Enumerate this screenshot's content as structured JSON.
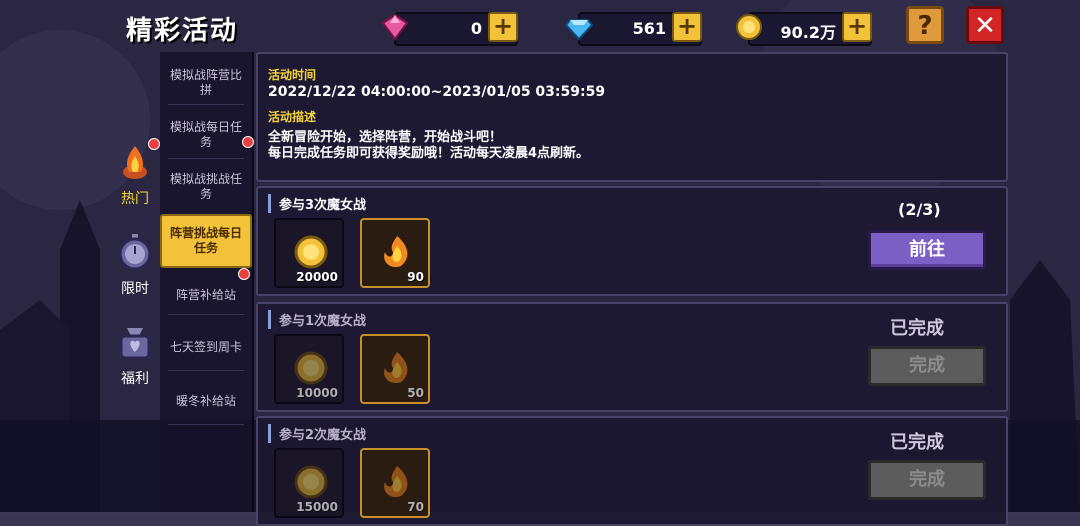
{
  "header": {
    "title": "精彩活动"
  },
  "currencies": [
    {
      "name": "pink-gem",
      "value": "0",
      "color": "#e85aa0"
    },
    {
      "name": "blue-diamond",
      "value": "561",
      "color": "#4ab8f0"
    },
    {
      "name": "gold-coin",
      "value": "90.2万",
      "color": "#f2c23a"
    }
  ],
  "buttons": {
    "help": "?",
    "close": "✕"
  },
  "left_tabs": [
    {
      "label": "热门",
      "icon": "fire-icon"
    },
    {
      "label": "限时",
      "icon": "stopwatch-icon"
    },
    {
      "label": "福利",
      "icon": "gift-bag-icon"
    }
  ],
  "sub_nav": [
    {
      "label": "模拟战阵营比拼"
    },
    {
      "label": "模拟战每日任务"
    },
    {
      "label": "模拟战挑战任务"
    },
    {
      "label": "阵营挑战每日任务"
    },
    {
      "label": "阵营补给站"
    },
    {
      "label": "七天签到周卡"
    },
    {
      "label": "暖冬补给站"
    }
  ],
  "info": {
    "time_label": "活动时间",
    "time_value": "2022/12/22 04:00:00~2023/01/05 03:59:59",
    "desc_label": "活动描述",
    "desc_line1": "全新冒险开始，选择阵营，开始战斗吧！",
    "desc_line2": "每日完成任务即可获得奖励哦！活动每天凌晨4点刷新。"
  },
  "tasks": [
    {
      "name": "参与3次魔女战",
      "rewards": [
        {
          "type": "gold-coin",
          "amount": "20000"
        },
        {
          "type": "fire-fragment",
          "amount": "90"
        }
      ],
      "progress": "(2/3)",
      "button": "前往",
      "state": "active"
    },
    {
      "name": "参与1次魔女战",
      "rewards": [
        {
          "type": "gold-coin",
          "amount": "10000"
        },
        {
          "type": "fire-fragment",
          "amount": "50"
        }
      ],
      "status": "已完成",
      "button": "完成",
      "state": "done"
    },
    {
      "name": "参与2次魔女战",
      "rewards": [
        {
          "type": "gold-coin",
          "amount": "15000"
        },
        {
          "type": "fire-fragment",
          "amount": "70"
        }
      ],
      "status": "已完成",
      "button": "完成",
      "state": "done"
    }
  ]
}
